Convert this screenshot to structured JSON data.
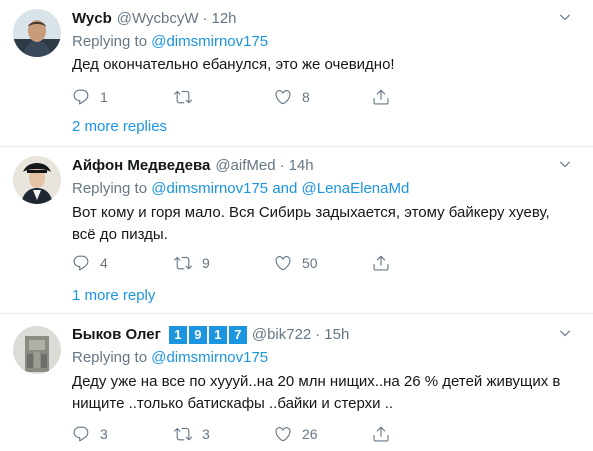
{
  "tweets": [
    {
      "name": "Wycb",
      "handle": "@WycbcyW",
      "time": "12h",
      "replying_prefix": "Replying to",
      "replying_to": "@dimsmirnov175",
      "text": "Дед окончательно ебанулся, это же очевидно!",
      "replies": "1",
      "retweets": "",
      "likes": "8",
      "more_replies": "2 more replies"
    },
    {
      "name": "Айфон Медведева",
      "handle": "@aifMed",
      "time": "14h",
      "replying_prefix": "Replying to",
      "replying_to": "@dimsmirnov175 and @LenaElenaMd",
      "text_line1": "Вот кому и горя мало. Вся Сибирь задыхается, этому байкеру хуеву,",
      "text_line2": "всё до пизды.",
      "replies": "4",
      "retweets": "9",
      "likes": "50",
      "more_replies": "1 more reply"
    },
    {
      "name": "Быков Олег",
      "badges": [
        "1",
        "9",
        "1",
        "7"
      ],
      "handle": "@bik722",
      "time": "15h",
      "replying_prefix": "Replying to",
      "replying_to": "@dimsmirnov175",
      "text_line1": "Деду уже на все по хуууй..на 20 млн нищих..на 26 % детей живущих в",
      "text_line2": "нищите ..только батискафы ..байки и стерхи ..",
      "replies": "3",
      "retweets": "3",
      "likes": "26"
    }
  ],
  "separator_dot": "·",
  "icons": {
    "reply": "reply-icon",
    "retweet": "retweet-icon",
    "like": "heart-icon",
    "share": "share-icon",
    "menu": "chevron-down-icon"
  },
  "colors": {
    "link": "#1b95e0",
    "muted": "#657786",
    "text": "#14171a",
    "divider": "#e6ecf0"
  }
}
